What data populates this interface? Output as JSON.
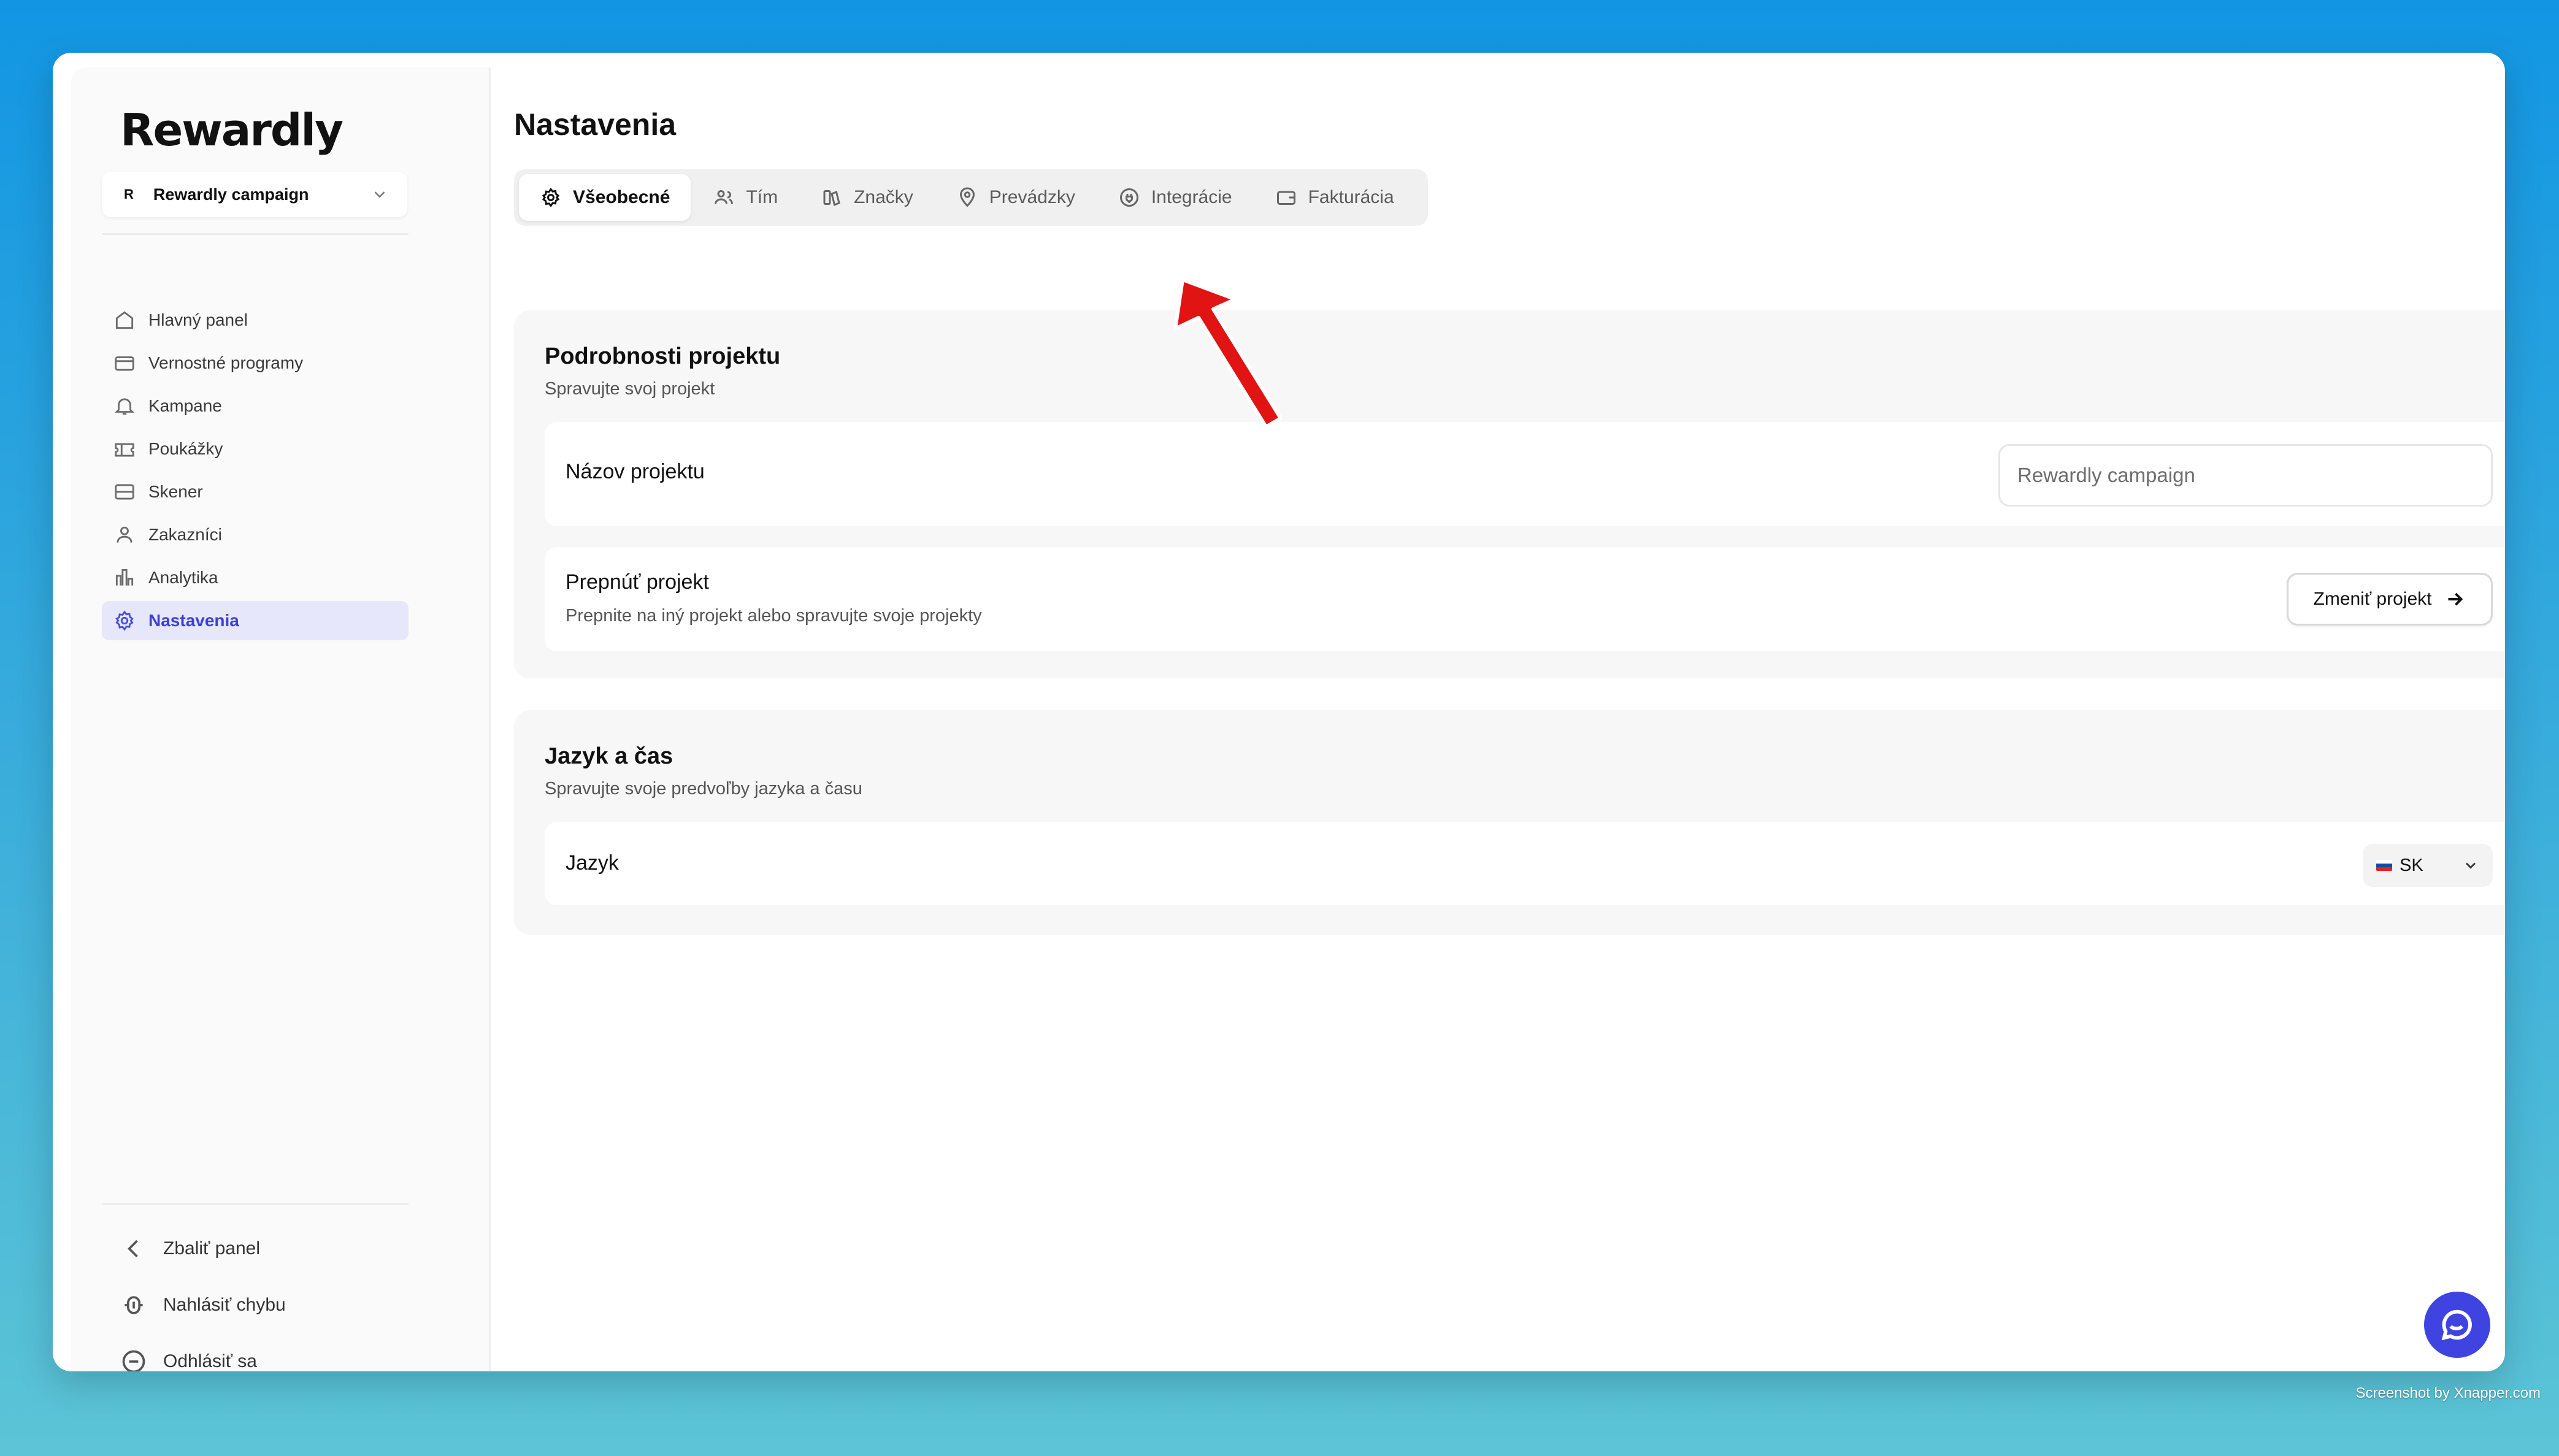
{
  "sidebar": {
    "logo": "Rewardly",
    "project": {
      "avatar": "R",
      "name": "Rewardly campaign"
    },
    "items": [
      {
        "label": "Hlavný panel",
        "icon": "home-icon"
      },
      {
        "label": "Vernostné programy",
        "icon": "card-icon"
      },
      {
        "label": "Kampane",
        "icon": "bell-icon"
      },
      {
        "label": "Poukážky",
        "icon": "ticket-icon"
      },
      {
        "label": "Skener",
        "icon": "scan-icon"
      },
      {
        "label": "Zakazníci",
        "icon": "users-icon"
      },
      {
        "label": "Analytika",
        "icon": "chart-icon"
      },
      {
        "label": "Nastavenia",
        "icon": "gear-icon",
        "active": true
      }
    ],
    "bottom": {
      "collapse": "Zbaliť panel",
      "report": "Nahlásiť chybu",
      "logout": "Odhlásiť sa"
    }
  },
  "main": {
    "title": "Nastavenia",
    "tabs": [
      {
        "label": "Všeobecné",
        "icon": "gear-icon",
        "active": true
      },
      {
        "label": "Tím",
        "icon": "users-icon"
      },
      {
        "label": "Značky",
        "icon": "brands-icon"
      },
      {
        "label": "Prevádzky",
        "icon": "pin-icon"
      },
      {
        "label": "Integrácie",
        "icon": "plug-icon"
      },
      {
        "label": "Fakturácia",
        "icon": "wallet-icon"
      }
    ],
    "project_card": {
      "title": "Podrobnosti projektu",
      "subtitle": "Spravujte svoj projekt",
      "name_label": "Názov projektu",
      "name_value": "Rewardly campaign",
      "switch_title": "Prepnúť projekt",
      "switch_desc": "Prepnite na iný projekt alebo spravujte svoje projekty",
      "switch_button": "Zmeniť projekt"
    },
    "lang_card": {
      "title": "Jazyk a čas",
      "subtitle": "Spravujte svoje predvoľby jazyka a času",
      "lang_label": "Jazyk",
      "lang_value": "SK"
    }
  },
  "colors": {
    "accent": "#3d3fd6",
    "active_bg": "#e6e7fb",
    "annotation_arrow": "#e11414"
  },
  "watermark": "Screenshot by Xnapper.com"
}
